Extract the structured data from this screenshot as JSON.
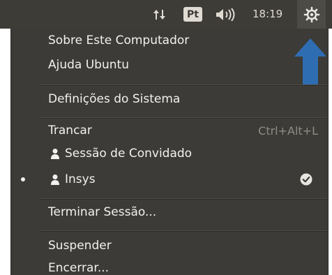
{
  "panel": {
    "lang_label": "Pt",
    "clock": "18:19",
    "icons": [
      "network-arrows-icon",
      "volume-icon",
      "gear-icon"
    ]
  },
  "menu": {
    "about": "Sobre Este Computador",
    "help": "Ajuda Ubuntu",
    "settings": "Definições do Sistema",
    "lock": "Trancar",
    "lock_shortcut": "Ctrl+Alt+L",
    "guest": "Sessão de Convidado",
    "user": "Insys",
    "logout": "Terminar Sessão...",
    "suspend": "Suspender",
    "shutdown": "Encerrar..."
  },
  "colors": {
    "panel_bg": "#3d3c37",
    "menu_bg": "#3c3b37",
    "text": "#f2f1f0",
    "arrow_blue": "#2f6db3"
  }
}
